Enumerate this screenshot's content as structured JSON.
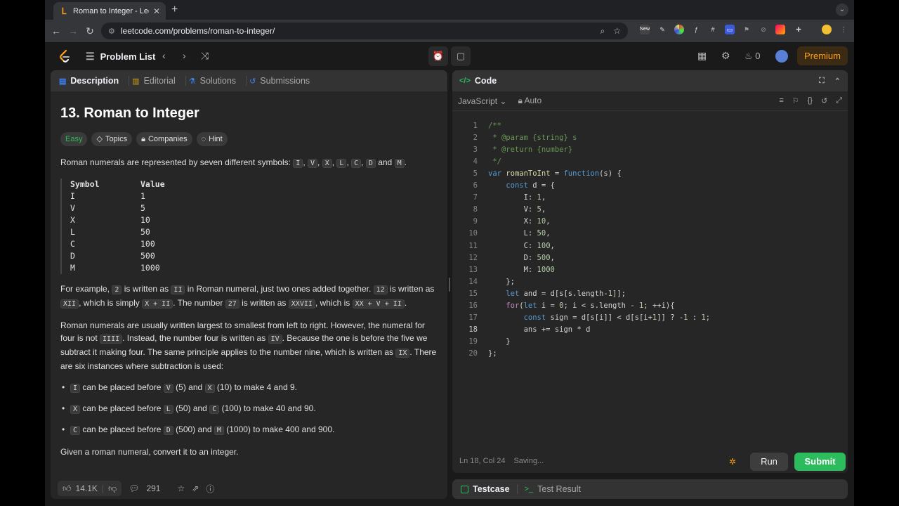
{
  "browser": {
    "tab_title": "Roman to Integer - LeetCode",
    "url": "leetcode.com/problems/roman-to-integer/",
    "ext_new_label": "New"
  },
  "header": {
    "problem_list": "Problem List",
    "streak": "0",
    "premium": "Premium"
  },
  "desc_tabs": [
    {
      "label": "Description",
      "icon": "document-icon",
      "color": "#3b82f6"
    },
    {
      "label": "Editorial",
      "icon": "book-icon",
      "color": "#d4a017"
    },
    {
      "label": "Solutions",
      "icon": "flask-icon",
      "color": "#3b82f6"
    },
    {
      "label": "Submissions",
      "icon": "history-icon",
      "color": "#3b82f6"
    }
  ],
  "problem": {
    "title": "13. Roman to Integer",
    "difficulty": "Easy",
    "topics": "Topics",
    "companies": "Companies",
    "hint": "Hint",
    "intro_text": "Roman numerals are represented by seven different symbols:",
    "symbols_inline": [
      "I",
      "V",
      "X",
      "L",
      "C",
      "D",
      "M"
    ],
    "and": "and",
    "table": {
      "headers": [
        "Symbol",
        "Value"
      ],
      "rows": [
        [
          "I",
          "1"
        ],
        [
          "V",
          "5"
        ],
        [
          "X",
          "10"
        ],
        [
          "L",
          "50"
        ],
        [
          "C",
          "100"
        ],
        [
          "D",
          "500"
        ],
        [
          "M",
          "1000"
        ]
      ]
    },
    "example_p": {
      "t1": "For example, ",
      "c1": "2",
      "t2": " is written as ",
      "c2": "II",
      "t3": " in Roman numeral, just two ones added together. ",
      "c3": "12",
      "t4": " is written as ",
      "c4": "XII",
      "t5": ", which is simply ",
      "c5": "X + II",
      "t6": ". The number ",
      "c6": "27",
      "t7": " is written as ",
      "c7": "XXVII",
      "t8": ", which is ",
      "c8": "XX + V + II",
      "t9": "."
    },
    "order_p": {
      "t1": "Roman numerals are usually written largest to smallest from left to right. However, the numeral for four is not ",
      "c1": "IIII",
      "t2": ". Instead, the number four is written as ",
      "c2": "IV",
      "t3": ". Because the one is before the five we subtract it making four. The same principle applies to the number nine, which is written as ",
      "c3": "IX",
      "t4": ". There are six instances where subtraction is used:"
    },
    "bullets": [
      {
        "c1": "I",
        "t1": " can be placed before ",
        "c2": "V",
        "t2": " (5) and ",
        "c3": "X",
        "t3": " (10) to make 4 and 9."
      },
      {
        "c1": "X",
        "t1": " can be placed before ",
        "c2": "L",
        "t2": " (50) and ",
        "c3": "C",
        "t3": " (100) to make 40 and 90."
      },
      {
        "c1": "C",
        "t1": " can be placed before ",
        "c2": "D",
        "t2": " (500) and ",
        "c3": "M",
        "t3": " (1000) to make 400 and 900."
      }
    ],
    "final_p": "Given a roman numeral, convert it to an integer."
  },
  "footer": {
    "likes": "14.1K",
    "comments": "291"
  },
  "code_panel": {
    "title": "Code",
    "language": "JavaScript",
    "auto": "Auto",
    "lines": [
      "/**",
      " * @param {string} s",
      " * @return {number}",
      " */",
      "var romanToInt = function(s) {",
      "    const d = {",
      "        I: 1,",
      "        V: 5,",
      "        X: 10,",
      "        L: 50,",
      "        C: 100,",
      "        D: 500,",
      "        M: 1000",
      "    };",
      "    let and = d[s[s.length-1]];",
      "    for(let i = 0; i < s.length - 1; ++i){",
      "        const sign = d[s[i]] < d[s[i+1]] ? -1 : 1;",
      "        ans += sign * d",
      "    }",
      "};"
    ],
    "cursor_line": 18,
    "status": "Ln 18, Col 24",
    "saving": "Saving...",
    "run": "Run",
    "submit": "Submit"
  },
  "bottom_tabs": {
    "testcase": "Testcase",
    "test_result": "Test Result"
  },
  "colors": {
    "accent_green": "#2cbb5d",
    "brand_orange": "#ffa116"
  }
}
